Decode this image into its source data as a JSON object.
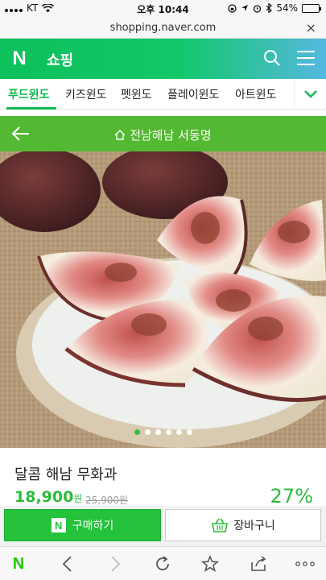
{
  "status_bar": {
    "carrier": "KT",
    "time": "오후 10:44",
    "battery": "54%",
    "battery_level": 0.54
  },
  "browser": {
    "url": "shopping.naver.com",
    "close_label": "×"
  },
  "header": {
    "logo": "N",
    "title": "쇼핑",
    "brand_color": "#12c86a"
  },
  "tabs": [
    {
      "label": "푸드윈도"
    },
    {
      "label": "키즈윈도"
    },
    {
      "label": "펫윈도"
    },
    {
      "label": "플레이윈도"
    },
    {
      "label": "아트윈도"
    }
  ],
  "location": {
    "label": "전남해남 서동명"
  },
  "gallery": {
    "slide_count": 6,
    "active_index": 0
  },
  "product": {
    "name": "달콤 해남 무화과",
    "price": "18,900",
    "price_unit": "원",
    "original_price": "25,900원",
    "discount": "27%"
  },
  "buttons": {
    "buy_logo": "N",
    "buy_label": "구매하기",
    "cart_label": "장바구니"
  },
  "toolbar": {
    "logo": "N",
    "icons": [
      "back-icon",
      "forward-icon",
      "reload-icon",
      "bookmark-star-icon",
      "share-icon",
      "more-icon"
    ]
  }
}
